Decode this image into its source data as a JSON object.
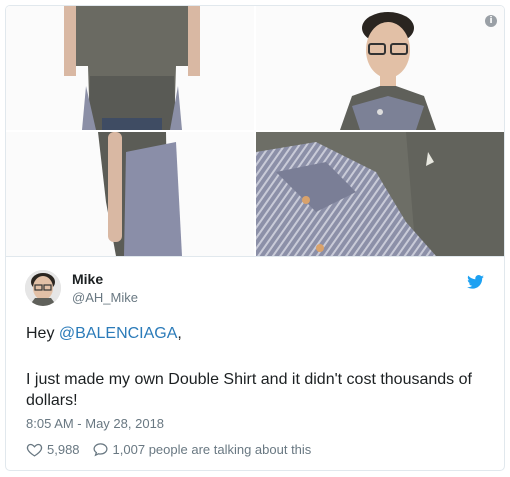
{
  "tweet": {
    "author_name": "Mike",
    "author_handle": "@AH_Mike",
    "text_prefix": "Hey ",
    "mention": "@BALENCIAGA",
    "text_suffix": ",",
    "body": "I just made my own Double Shirt and it didn't cost thousands of dollars!",
    "timestamp": "8:05 AM - May 28, 2018",
    "likes": "5,988",
    "replies_text": "1,007 people are talking about this"
  },
  "icons": {
    "info": "info-icon",
    "bird": "twitter-bird-icon",
    "like": "heart-icon",
    "reply": "speech-bubble-icon"
  },
  "colors": {
    "link": "#2b7bb9",
    "twitter_blue": "#1da1f2",
    "muted": "#697882"
  }
}
